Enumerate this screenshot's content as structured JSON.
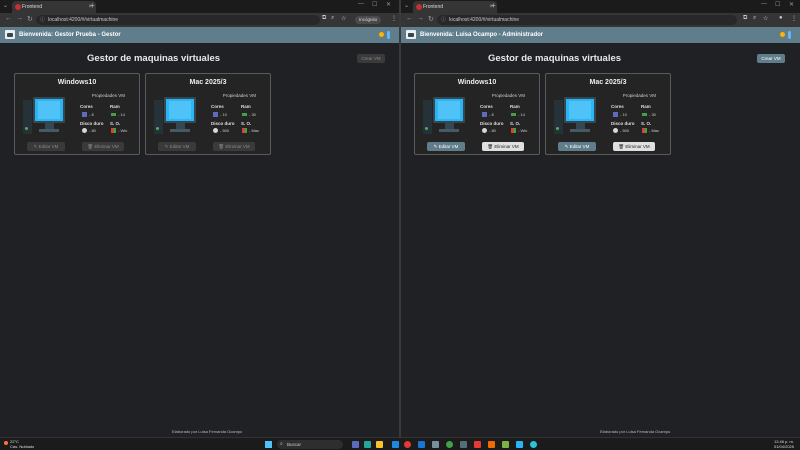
{
  "browser": {
    "tab_title": "Frontend",
    "url": "localhost:4200/#/virtualmachine",
    "incognito_label": "Incógnito"
  },
  "left": {
    "welcome": "Bienvenida: Gestor Prueba - Gestor",
    "page_title": "Gestor de maquinas virtuales",
    "create_label": "Crear VM",
    "buttons_enabled": false
  },
  "right": {
    "welcome": "Bienvenida: Luisa Ocampo - Administrador",
    "page_title": "Gestor de maquinas virtuales",
    "create_label": "Crear VM",
    "buttons_enabled": true
  },
  "vms": [
    {
      "name": "Windows10",
      "props_label": "Propiedades VM",
      "cores_label": "Cores",
      "cores": "8",
      "ram_label": "Ram",
      "ram": "14",
      "disk_label": "Disco duro",
      "disk": "80",
      "os_label": "S. O.",
      "os": "Win"
    },
    {
      "name": "Mac 2025/3",
      "props_label": "Propiedades VM",
      "cores_label": "Cores",
      "cores": "10",
      "ram_label": "Ram",
      "ram": "30",
      "disk_label": "Disco duro",
      "disk": "500",
      "os_label": "S. O.",
      "os": "Mac"
    }
  ],
  "card_buttons": {
    "edit": "Editar VM",
    "delete": "Eliminar VM"
  },
  "footer": "Elaborado por Luisa Fernanda Ocampo",
  "taskbar": {
    "weather_temp": "22°C",
    "weather_desc": "Cas. Nublado",
    "search_label": "Buscar",
    "time": "12:46 p. m.",
    "date": "01/04/2025"
  },
  "colors": {
    "topbar": "#607d8b",
    "accent_sun": "#ffb300",
    "monitor": "#29b6f6"
  }
}
